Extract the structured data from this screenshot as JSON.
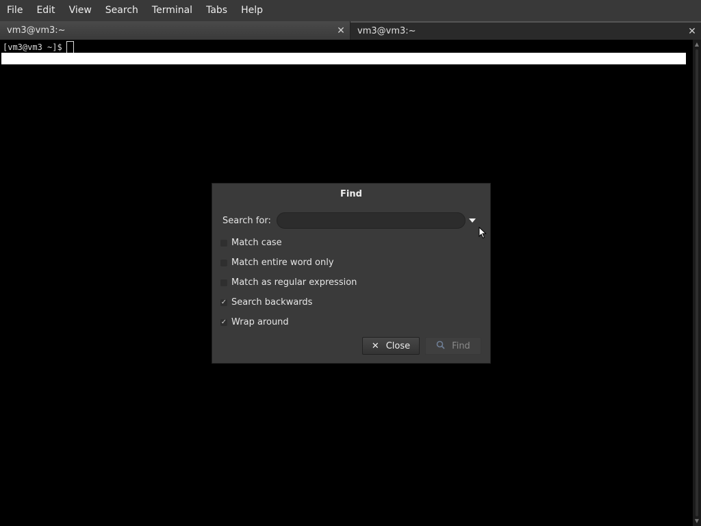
{
  "menu": [
    "File",
    "Edit",
    "View",
    "Search",
    "Terminal",
    "Tabs",
    "Help"
  ],
  "tabs": [
    {
      "label": "vm3@vm3:~",
      "close_icon": "close-icon"
    },
    {
      "label": "vm3@vm3:~",
      "close_icon": "close-icon"
    }
  ],
  "terminal": {
    "prompt": "[vm3@vm3 ~]$"
  },
  "dialog": {
    "title": "Find",
    "search_label": "Search for:",
    "search_value": "",
    "options": [
      {
        "label": "Match case",
        "checked": false
      },
      {
        "label": "Match entire word only",
        "checked": false
      },
      {
        "label": "Match as regular expression",
        "checked": false
      },
      {
        "label": "Search backwards",
        "checked": true
      },
      {
        "label": "Wrap around",
        "checked": true
      }
    ],
    "close_button": "Close",
    "find_button": "Find"
  },
  "colors": {
    "menubar": "#393939",
    "terminal_bg": "#000000",
    "dialog_bg": "#3a3a3a",
    "highlight": "#ffffff"
  }
}
